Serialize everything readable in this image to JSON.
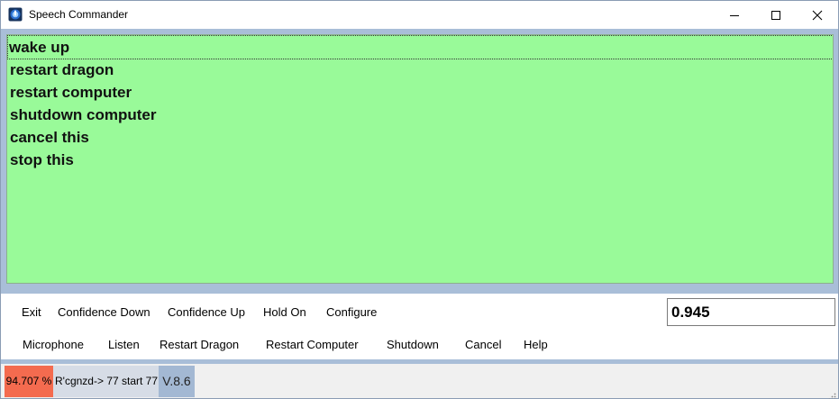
{
  "window": {
    "title": "Speech Commander",
    "icon": "app-speech-icon"
  },
  "commands": [
    {
      "label": "wake up",
      "selected": true
    },
    {
      "label": "restart dragon",
      "selected": false
    },
    {
      "label": "restart computer",
      "selected": false
    },
    {
      "label": "shutdown computer",
      "selected": false
    },
    {
      "label": "cancel this",
      "selected": false
    },
    {
      "label": "stop this",
      "selected": false
    }
  ],
  "toolbar": {
    "row1": [
      "Exit",
      "Confidence Down",
      "Confidence Up",
      "Hold On",
      "Configure"
    ],
    "row2": [
      "Microphone",
      "Listen",
      "Restart Dragon",
      "Restart Computer",
      "Shutdown",
      "Cancel",
      "Help"
    ]
  },
  "confidence": {
    "value": "0.945"
  },
  "status": {
    "percent": "94.707 %",
    "recognized": "R'cgnzd-> 77 start 77",
    "version": "V.8.6"
  },
  "colors": {
    "list_bg": "#99fa99",
    "percent_bg": "#f46b4f",
    "window_bg": "#a9bed8",
    "version_bg": "#a3b8d3"
  }
}
